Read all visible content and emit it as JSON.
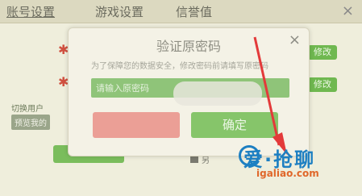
{
  "header": {
    "tabs": [
      {
        "label": "账号设置"
      },
      {
        "label": "游戏设置"
      },
      {
        "label": "信誉值"
      }
    ],
    "close_glyph": "×"
  },
  "background": {
    "modify_label": "修改",
    "switch_label": "切换用户",
    "left_chip": "预览我的"
  },
  "dialog": {
    "title": "验证原密码",
    "tip": "为了保障您的数据安全，修改密码前请填写原密码",
    "input_placeholder": "请输入原密码",
    "confirm_label": "确定",
    "close_glyph": "×"
  },
  "watermark": {
    "brand": "爱·抢聊",
    "url": "igaliao.com"
  },
  "colors": {
    "accent_green": "#86c56a",
    "cancel_red": "#eb9f96",
    "arrow_red": "#e33a3a"
  }
}
